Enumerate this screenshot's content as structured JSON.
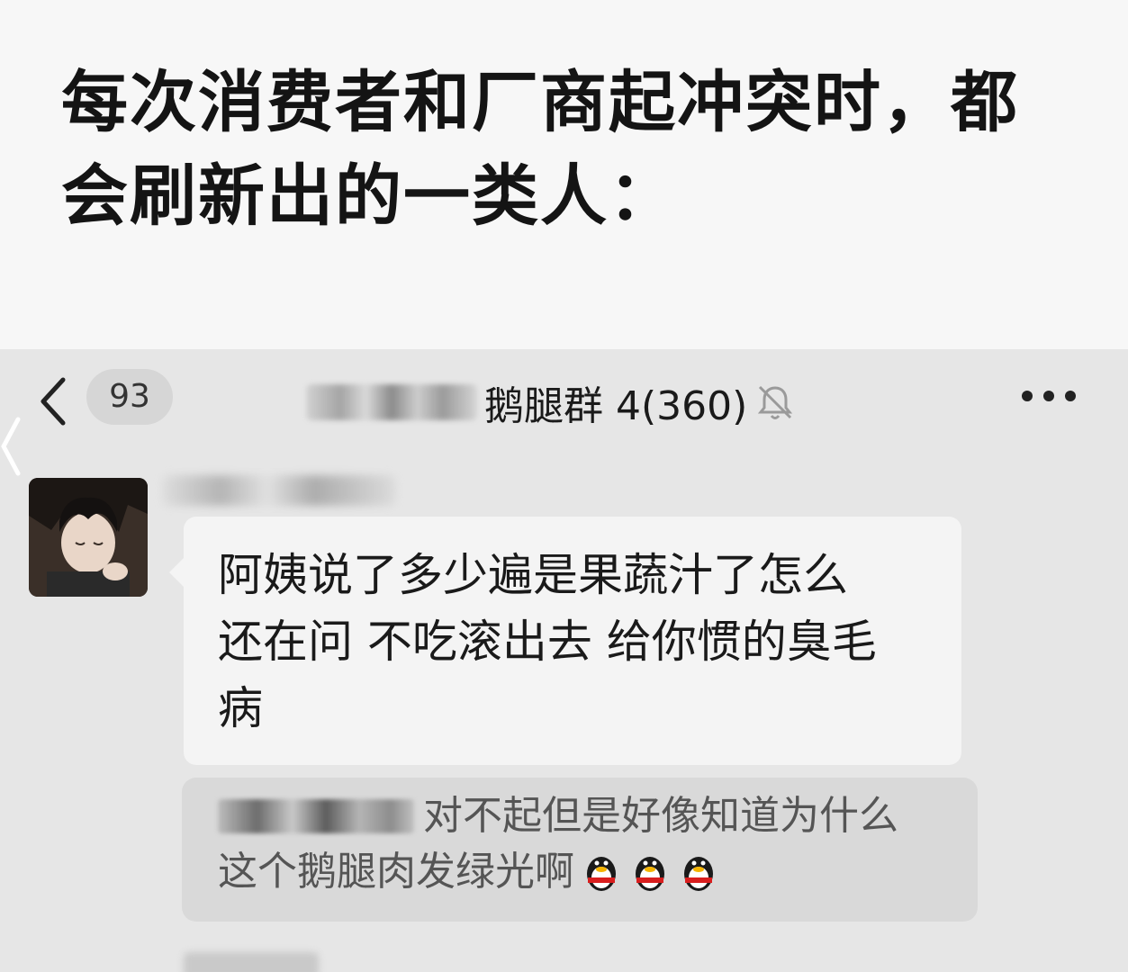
{
  "caption": {
    "line1": "每次消费者和厂商起冲突时，都",
    "line2": "会刷新出的一类人："
  },
  "chat": {
    "back_count": "93",
    "group_name": "鹅腿群 4(360)",
    "group_name_redacted": true,
    "muted": true,
    "message_text": [
      "阿姨说了多少遍是果蔬汁了怎么",
      "还在问 不吃滚出去 给你惯的臭毛",
      "病"
    ],
    "quoted_reply": {
      "line1": "对不起但是好像知道为什么",
      "line2": "这个鹅腿肉发绿光啊",
      "emoji": [
        "penguin-emoji",
        "penguin-emoji",
        "penguin-emoji"
      ]
    }
  },
  "colors": {
    "page_bg": "#f7f7f7",
    "chat_bg": "#e6e6e6",
    "bubble_bg": "#f4f4f4",
    "quote_bg": "#d9d9d9",
    "emoji_red": "#d91e1e"
  },
  "icons": [
    "chevron-left-icon",
    "bell-off-icon",
    "more-icon",
    "penguin-emoji"
  ]
}
